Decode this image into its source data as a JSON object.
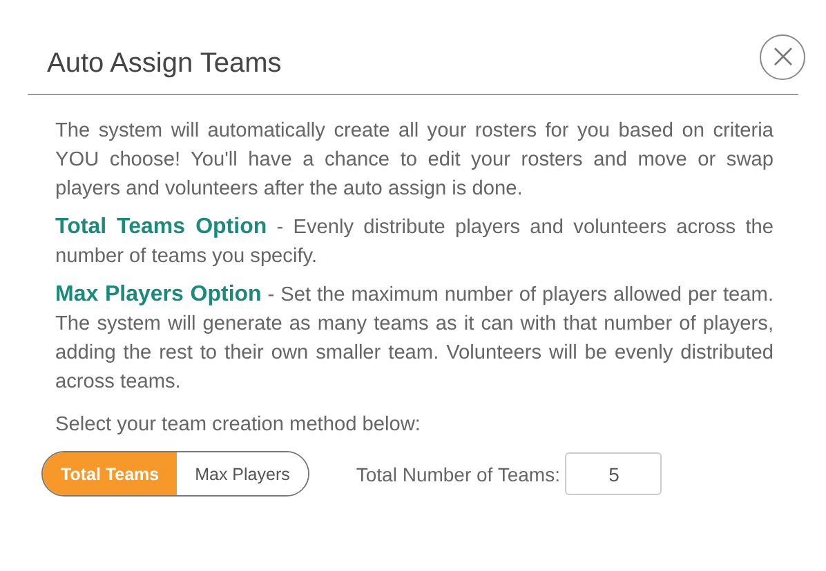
{
  "dialog": {
    "title": "Auto Assign Teams"
  },
  "intro": "The system will automatically create all your rosters for you based on criteria YOU choose! You'll have a chance to edit your rosters and move or swap players and volunteers after the auto assign is done.",
  "options": [
    {
      "title": "Total Teams Option",
      "description": " - Evenly distribute players and volunteers across the number of teams you specify."
    },
    {
      "title": "Max Players Option",
      "description": " - Set the maximum number of players allowed per team. The system will generate as many teams as it can with that number of players, adding the rest to their own smaller team. Volunteers will be evenly distributed across teams."
    }
  ],
  "prompt": "Select your team creation method below:",
  "methods": [
    {
      "label": "Total Teams",
      "selected": true
    },
    {
      "label": "Max Players",
      "selected": false
    }
  ],
  "count": {
    "label": "Total Number of Teams:",
    "value": "5"
  }
}
